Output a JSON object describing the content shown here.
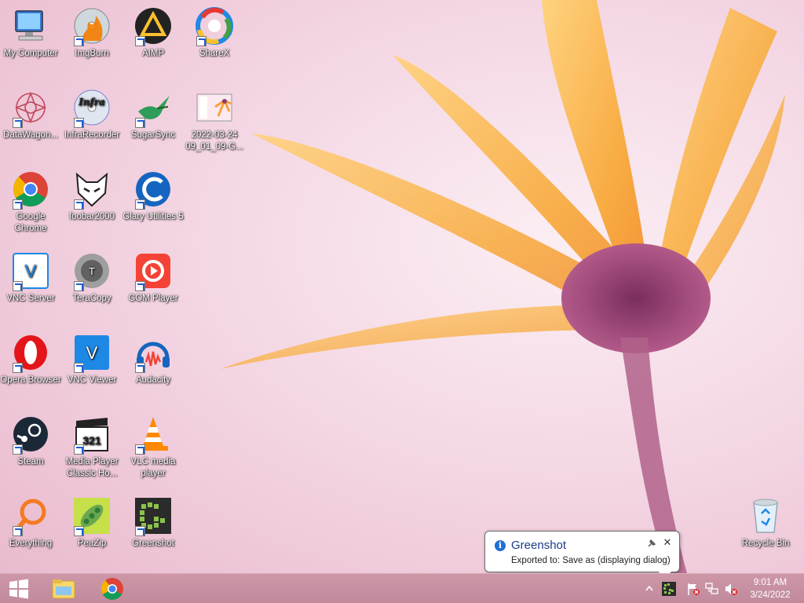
{
  "desktop": {
    "icons": [
      {
        "id": "my-computer",
        "label": "My Computer",
        "icon": "computer-icon"
      },
      {
        "id": "imgburn",
        "label": "ImgBurn",
        "icon": "disc-flame-icon"
      },
      {
        "id": "aimp",
        "label": "AIMP",
        "icon": "aimp-triangle-icon"
      },
      {
        "id": "sharex",
        "label": "ShareX",
        "icon": "sharex-icon"
      },
      {
        "id": "datawagon",
        "label": "DataWagon...",
        "icon": "datawagon-icon"
      },
      {
        "id": "infrarecorder",
        "label": "InfraRecorder",
        "icon": "infrarecorder-disc-icon"
      },
      {
        "id": "sugarsync",
        "label": "SugarSync",
        "icon": "hummingbird-icon"
      },
      {
        "id": "screenshot-file",
        "label": "2022-03-24 09_01_09-G...",
        "icon": "image-file-icon"
      },
      {
        "id": "google-chrome",
        "label": "Google Chrome",
        "icon": "chrome-icon"
      },
      {
        "id": "foobar2000",
        "label": "foobar2000",
        "icon": "foobar-cat-icon"
      },
      {
        "id": "glary-utilities",
        "label": "Glary Utilities 5",
        "icon": "glary-icon"
      },
      {
        "id": "vnc-server",
        "label": "VNC Server",
        "icon": "vnc-server-icon"
      },
      {
        "id": "teracopy",
        "label": "TeraCopy",
        "icon": "teracopy-icon"
      },
      {
        "id": "gom-player",
        "label": "GOM Player",
        "icon": "gom-player-icon"
      },
      {
        "id": "opera-browser",
        "label": "Opera Browser",
        "icon": "opera-icon"
      },
      {
        "id": "vnc-viewer",
        "label": "VNC Viewer",
        "icon": "vnc-viewer-icon"
      },
      {
        "id": "audacity",
        "label": "Audacity",
        "icon": "audacity-headphones-icon"
      },
      {
        "id": "steam",
        "label": "Steam",
        "icon": "steam-icon"
      },
      {
        "id": "mpc-hc",
        "label": "Media Player Classic Ho...",
        "icon": "mpc-clapper-icon"
      },
      {
        "id": "vlc",
        "label": "VLC media player",
        "icon": "vlc-cone-icon"
      },
      {
        "id": "everything",
        "label": "Everything",
        "icon": "everything-magnifier-icon"
      },
      {
        "id": "peazip",
        "label": "PeaZip",
        "icon": "peazip-icon"
      },
      {
        "id": "greenshot",
        "label": "Greenshot",
        "icon": "greenshot-icon"
      },
      {
        "id": "recycle-bin",
        "label": "Recycle Bin",
        "icon": "recycle-bin-icon"
      }
    ]
  },
  "notification": {
    "title": "Greenshot",
    "message": "Exported to: Save as (displaying dialog)"
  },
  "taskbar": {
    "pinned": [
      "start-icon",
      "file-explorer-icon",
      "chrome-icon"
    ],
    "clock": {
      "time": "9:01 AM",
      "date": "3/24/2022"
    }
  },
  "colors": {
    "taskbar": "#c08a9c",
    "balloon_title": "#1e3a8a",
    "info_blue": "#1f6fd6"
  }
}
